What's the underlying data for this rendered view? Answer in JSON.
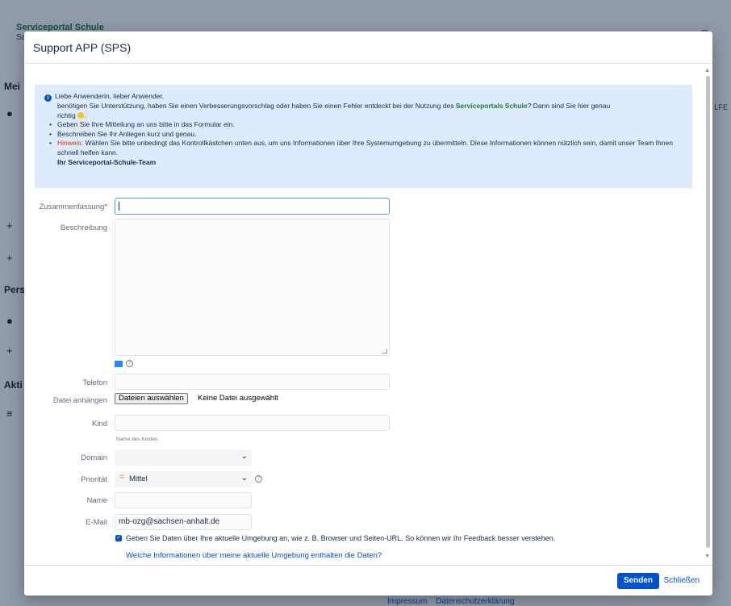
{
  "background": {
    "brand": "Serviceportal Schule",
    "brand_sub": "Sa",
    "side_labels": [
      "Mei",
      "Pers",
      "Akti"
    ],
    "right_text": "LFE",
    "footer_links": [
      "Impressum",
      "Datenschutzerklärung"
    ]
  },
  "modal": {
    "title": "Support APP (SPS)",
    "info": {
      "greeting": "Liebe Anwenderin, lieber Anwender,",
      "intro_before": "benötigen Sie Unterstützung, haben Sie einen Verbesserungsvorschlag oder haben Sie einen Fehler entdeckt bei der Nutzung des",
      "intro_brand": "Serviceportals Schule",
      "intro_after": "? Dann sind Sie hier genau",
      "intro_end": "richtig",
      "bullet1": "Geben Sie Ihre Mitteilung an uns bitte in das Formular ein.",
      "bullet2": "Beschreiben Sie Ihr Anliegen kurz und genau.",
      "bullet3_label": "Hinweis:",
      "bullet3_text": "Wählen Sie bitte unbedingt das Kontrollkästchen unten aus, um uns Informationen über Ihre Systemumgebung zu übermitteln. Diese Informationen können nützlich sein, damit unser Team Ihnen schnell helfen kann.",
      "signature": "Ihr Serviceportal-Schule-Team"
    },
    "fields": {
      "summary_label": "Zusammenfassung",
      "summary_required": "*",
      "summary_value": "",
      "description_label": "Beschreibung",
      "description_value": "",
      "phone_label": "Telefon",
      "phone_value": "",
      "attach_label": "Datei anhängen",
      "attach_button": "Dateien auswählen",
      "attach_status": "Keine Datei ausgewählt",
      "child_label": "Kind",
      "child_value": "",
      "child_hint": "Name des Kindes",
      "domain_label": "Domain",
      "domain_value": "",
      "priority_label": "Priorität",
      "priority_value": "Mittel",
      "name_label": "Name",
      "name_value": "",
      "email_label": "E-Mail",
      "email_value": "mb-ozg@sachsen-anhalt.de"
    },
    "env_checkbox_checked": true,
    "env_checkbox_label": "Geben Sie Daten über Ihre aktuelle Umgebung an, wie z. B. Browser und Seiten-URL. So können wir Ihr Feedback besser verstehen.",
    "env_link": "Welche Informationen über meine aktuelle Umgebung enthalten die Daten?",
    "send_button": "Senden",
    "close_button": "Schließen"
  },
  "colors": {
    "accent": "#0052cc",
    "brand_green": "#1e7a34",
    "info_bg": "#deebff",
    "warning_red": "#de350b",
    "priority_medium": "#ff991f"
  }
}
